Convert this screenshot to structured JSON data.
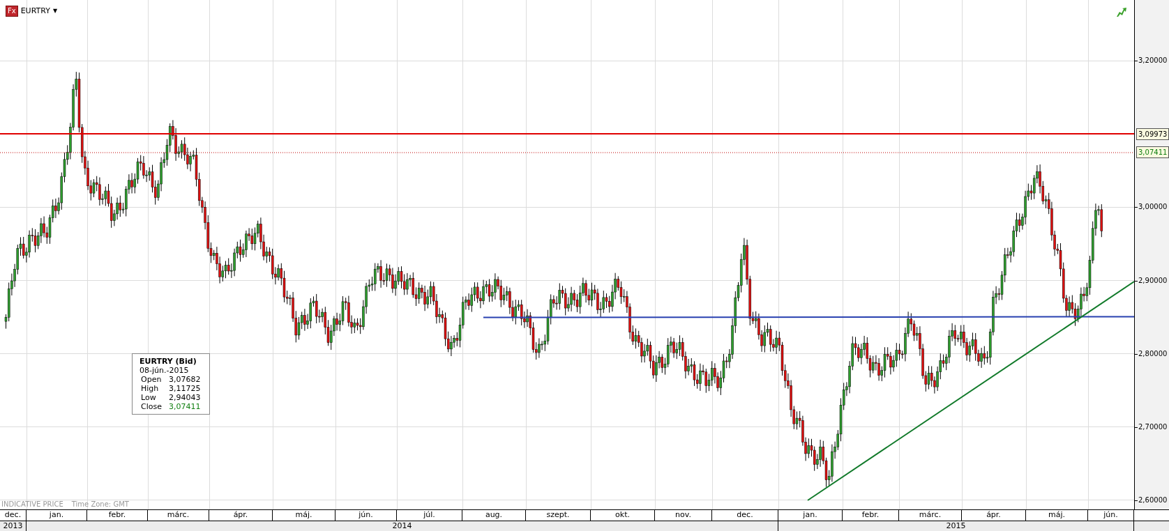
{
  "header": {
    "badge": "Fx",
    "symbol": "EURTRY",
    "dropdown": "▼"
  },
  "chart": {
    "y_axis_labels": [
      "3,20000",
      "3,00000",
      "2,90000",
      "2,80000",
      "2,70000",
      "2,60000"
    ],
    "price_tags": [
      {
        "label": "3,09973",
        "kind": "level"
      },
      {
        "label": "3,07411",
        "kind": "last"
      }
    ],
    "footer_note": "INDICATIVE PRICE",
    "time_zone": "Time Zone: GMT",
    "months": [
      "dec.",
      "jan.",
      "febr.",
      "márc.",
      "ápr.",
      "máj.",
      "jún.",
      "júl.",
      "aug.",
      "szept.",
      "okt.",
      "nov.",
      "dec.",
      "jan.",
      "febr.",
      "márc.",
      "ápr.",
      "máj.",
      "jún."
    ],
    "years": [
      "2013",
      "2014",
      "2015"
    ]
  },
  "tooltip": {
    "title": "EURTRY (Bid)",
    "date": "08-jún.-2015",
    "rows": [
      {
        "label": "Open",
        "value": "3,07682",
        "kind": "plain"
      },
      {
        "label": "High",
        "value": "3,11725",
        "kind": "plain"
      },
      {
        "label": "Low",
        "value": "2,94043",
        "kind": "plain"
      },
      {
        "label": "Close",
        "value": "3,07411",
        "kind": "close"
      }
    ]
  }
}
